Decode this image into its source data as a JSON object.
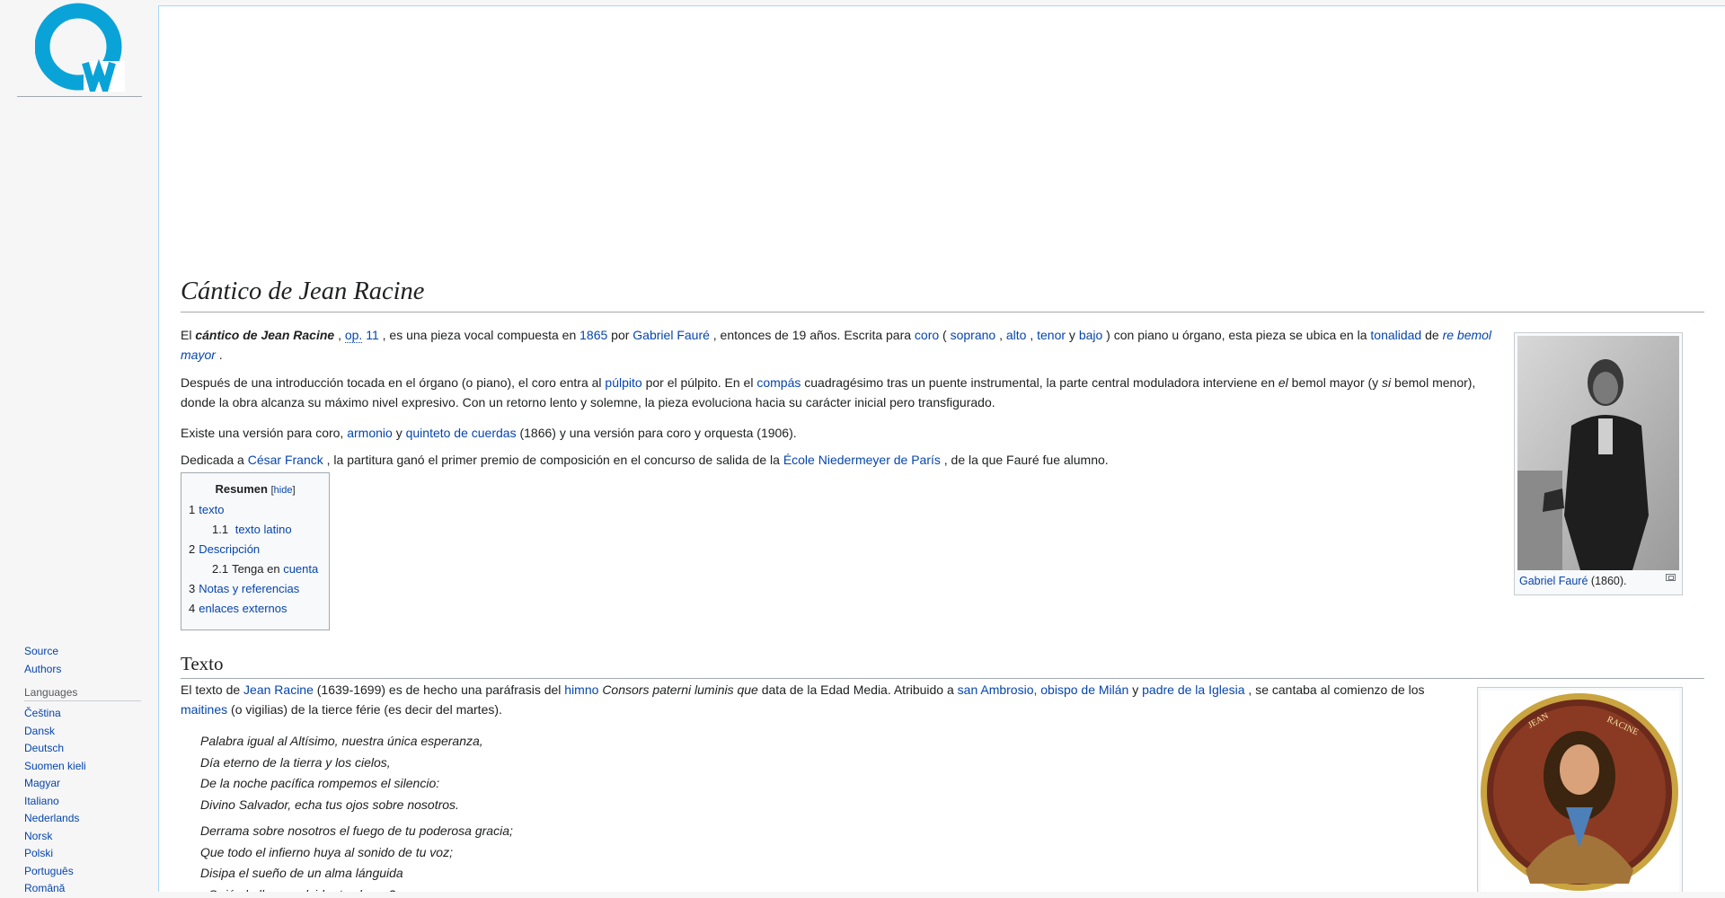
{
  "sidebar": {
    "logo_letter": "w",
    "links": [
      {
        "label": "Source"
      },
      {
        "label": "Authors"
      }
    ],
    "languages_heading": "Languages",
    "languages": [
      "Čeština",
      "Dansk",
      "Deutsch",
      "Suomen kieli",
      "Magyar",
      "Italiano",
      "Nederlands",
      "Norsk",
      "Polski",
      "Português",
      "Română"
    ]
  },
  "page": {
    "title": "Cántico de Jean Racine",
    "p1": {
      "t1": "El ",
      "bold": "cántico de Jean Racine",
      "t2": " , ",
      "op": "op.",
      "t3": " ",
      "op_num": "11",
      "t4": " , es una pieza vocal compuesta en ",
      "year_link": "1865",
      "t5": " por ",
      "faure_link": "Gabriel Fauré",
      "t6": " , entonces de 19 años. Escrita para ",
      "coro_link": "coro",
      "t7": " ( ",
      "soprano_link": "soprano",
      "t8": " , ",
      "alto_link": "alto",
      "t9": " , ",
      "tenor_link": "tenor",
      "t10": " y ",
      "bajo_link": "bajo",
      "t11": " ) con piano u órgano, esta pieza se ubica en la ",
      "tonalidad_link": "tonalidad",
      "t12": " de ",
      "rebemol_link": "re bemol mayor",
      "t13": " ."
    },
    "p2": {
      "t1": "Después de una introducción tocada en el órgano (o piano), el coro entra al ",
      "pulpito_link": "púlpito",
      "t2": " por el púlpito. En el ",
      "compas_link": "compás",
      "t3": " cuadragésimo tras un puente instrumental, la parte central moduladora interviene en ",
      "el_italic": "el",
      "t4": " bemol mayor (y ",
      "si_italic": "si",
      "t5": " bemol menor), donde la obra alcanza su máximo nivel expresivo. Con un retorno lento y solemne, la pieza evoluciona hacia su carácter inicial pero transfigurado."
    },
    "p3": {
      "t1": "Existe una versión para coro, ",
      "armonio_link": "armonio",
      "t2": " y ",
      "quinteto_link": "quinteto de cuerdas",
      "t3": " (1866) y una versión para coro y orquesta (1906)."
    },
    "p4": {
      "t1": "Dedicada a ",
      "franck_link": "César Franck",
      "t2": " , la partitura ganó el primer premio de composición en el concurso de salida de la ",
      "ecole_link": "École Niedermeyer de París",
      "t3": " , de la que Fauré fue alumno."
    },
    "thumb1": {
      "caption_link": "Gabriel Fauré",
      "caption_text": " (1860)."
    },
    "toc": {
      "title": "Resumen",
      "hide_open": "[",
      "hide": "hide",
      "hide_close": "]",
      "items": [
        {
          "num": "1",
          "label": "texto"
        },
        {
          "num": "1.1",
          "label": "texto latino"
        },
        {
          "num": "2",
          "label": "Descripción"
        },
        {
          "num": "2.1",
          "label_plain": "Tenga en ",
          "label": "cuenta"
        },
        {
          "num": "3",
          "label": "Notas y referencias"
        },
        {
          "num": "4",
          "label": "enlaces externos"
        }
      ]
    },
    "section_texto": "Texto",
    "p5": {
      "t1": "El texto de ",
      "racine_link": "Jean Racine",
      "t2": " (1639-1699) es de hecho una paráfrasis del ",
      "himno_link": "himno",
      "t3": " ",
      "consors_italic": "Consors paterni luminis que",
      "t4": " data de la Edad Media. Atribuido a ",
      "ambrosio_link": "san Ambrosio, obispo de Milán",
      "t5": " y ",
      "padre_link": "padre de la Iglesia",
      "t6": " , se cantaba al comienzo de los ",
      "maitines_link": "maitines",
      "t7": " (o vigilias) de la tierce férie (es decir del martes)."
    },
    "medallion_text": [
      "JEAN",
      "RACINE"
    ],
    "poem_stanza1": [
      "Palabra igual al Altísimo, nuestra única esperanza,",
      "Día eterno de la tierra y los cielos,",
      "De la noche pacífica rompemos el silencio:",
      "Divino Salvador, echa tus ojos sobre nosotros."
    ],
    "poem_stanza2": [
      "Derrama sobre nosotros el fuego de tu poderosa gracia;",
      "Que todo el infierno huya al sonido de tu voz;",
      "Disipa el sueño de un alma lánguida",
      "¿Quién la lleva a olvidar tus leyes?"
    ]
  },
  "colors": {
    "link": "#0645ad",
    "logo_blue": "#0aa3d8",
    "border_blue": "#a7d7f9"
  }
}
